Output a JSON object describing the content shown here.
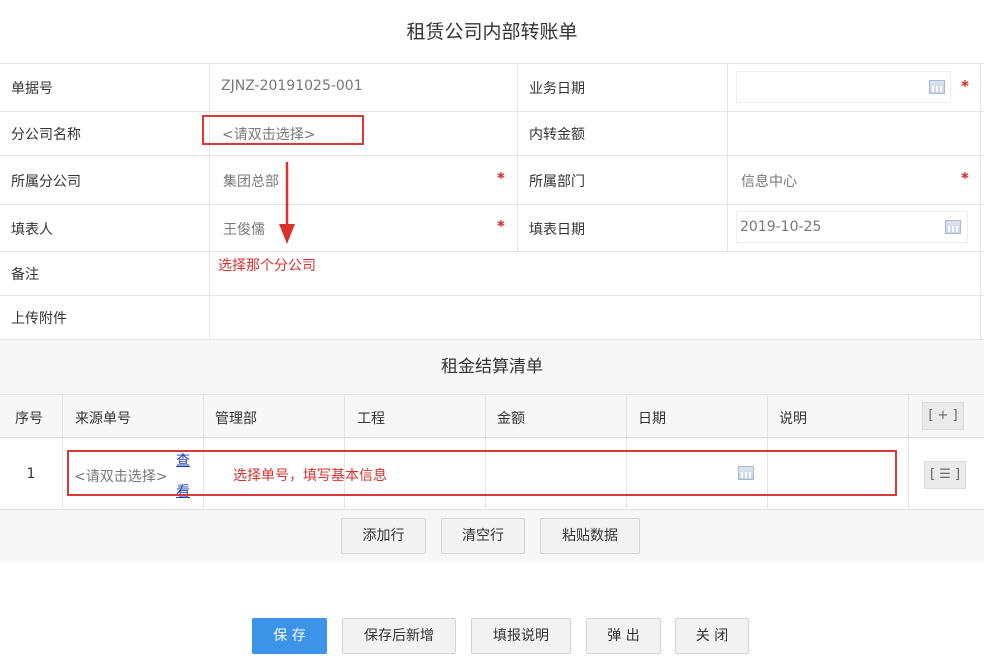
{
  "form_title": "租赁公司内部转账单",
  "fields": {
    "doc_no_label": "单据号",
    "doc_no_value": "ZJNZ-20191025-001",
    "biz_date_label": "业务日期",
    "branch_name_label": "分公司名称",
    "branch_name_placeholder": "<请双击选择>",
    "transfer_amount_label": "内转金额",
    "parent_company_label": "所属分公司",
    "parent_company_value": "集团总部",
    "department_label": "所属部门",
    "department_value": "信息中心",
    "filler_label": "填表人",
    "filler_value": "王俊儒",
    "fill_date_label": "填表日期",
    "fill_date_value": "2019-10-25",
    "remark_label": "备注",
    "attachment_label": "上传附件",
    "required_mark": "*"
  },
  "annotations": {
    "choose_branch": "选择那个分公司",
    "choose_doc": "选择单号，填写基本信息"
  },
  "detail": {
    "title": "租金结算清单",
    "columns": [
      "序号",
      "来源单号",
      "管理部",
      "工程",
      "金额",
      "日期",
      "说明"
    ],
    "add_col_btn": "[ + ]",
    "row": {
      "seq": "1",
      "source_placeholder": "<请双击选择>",
      "view_link_1": "查",
      "view_link_2": "看",
      "row_menu_btn": "[ ☰ ]"
    },
    "buttons": {
      "add_row": "添加行",
      "clear_rows": "清空行",
      "paste_data": "粘贴数据"
    }
  },
  "footer_buttons": {
    "save": "保 存",
    "save_new": "保存后新增",
    "instructions": "填报说明",
    "popup": "弹 出",
    "close": "关 闭"
  },
  "colors": {
    "primary": "#3b94e8",
    "required": "#e02020",
    "annotation": "#d9322e",
    "link": "#1a3fb0"
  }
}
